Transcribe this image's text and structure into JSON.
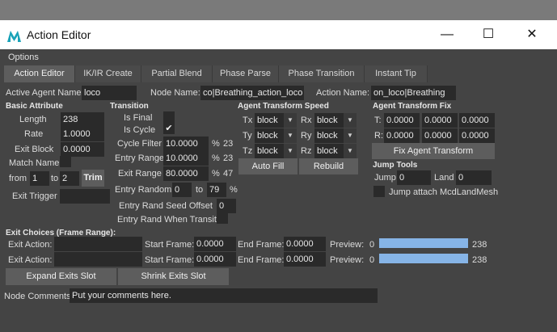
{
  "window": {
    "title": "Action Editor",
    "minimize": "—",
    "maximize": "☐",
    "close": "✕"
  },
  "menu": {
    "options": "Options"
  },
  "tabs": [
    "Action Editor",
    "IK/IR Create",
    "Partial Blend",
    "Phase Parse",
    "Phase Transition",
    "Instant Tip"
  ],
  "top": {
    "active_agent_label": "Active Agent Name:",
    "active_agent_value": "loco",
    "node_name_label": "Node Name:",
    "node_name_value": "co|Breathing_action_loco",
    "action_name_label": "Action Name:",
    "action_name_value": "on_loco|Breathing"
  },
  "basic": {
    "header": "Basic Attribute",
    "length_label": "Length",
    "length_value": "238",
    "rate_label": "Rate",
    "rate_value": "1.0000",
    "exit_block_label": "Exit Block",
    "exit_block_value": "0.0000",
    "match_name_label": "Match Name",
    "from_label": "from",
    "from_value": "1",
    "to_label": "to",
    "to_value": "2",
    "trim_label": "Trim",
    "exit_trigger_label": "Exit Trigger"
  },
  "transition": {
    "header": "Transition",
    "is_final_label": "Is Final",
    "is_cycle_label": "Is Cycle",
    "is_cycle_check": "✔",
    "cycle_filter_label": "Cycle Filter",
    "cycle_filter_value": "10.0000",
    "cycle_filter_pct": "%",
    "cycle_filter_num": "23",
    "entry_range_label": "Entry Range",
    "entry_range_value": "10.0000",
    "entry_range_pct": "%",
    "entry_range_num": "23",
    "exit_range_label": "Exit Range",
    "exit_range_value": "80.0000",
    "exit_range_pct": "%",
    "exit_range_num": "47",
    "entry_random_label": "Entry Random",
    "entry_random_from": "0",
    "entry_random_to_label": "to",
    "entry_random_to": "79",
    "entry_random_pct": "%",
    "seed_offset_label": "Entry Rand Seed Offset",
    "seed_offset_value": "0",
    "when_transit_label": "Entry Rand When Transit"
  },
  "agent_speed": {
    "header": "Agent Transform Speed",
    "tx_label": "Tx",
    "tx_value": "block",
    "ty_label": "Ty",
    "ty_value": "block",
    "tz_label": "Tz",
    "tz_value": "block",
    "rx_label": "Rx",
    "rx_value": "block",
    "ry_label": "Ry",
    "ry_value": "block",
    "rz_label": "Rz",
    "rz_value": "block",
    "auto_fill_label": "Auto Fill",
    "rebuild_label": "Rebuild"
  },
  "agent_fix": {
    "header": "Agent Transform Fix",
    "t_label": "T:",
    "t_values": [
      "0.0000",
      "0.0000",
      "0.0000"
    ],
    "r_label": "R:",
    "r_values": [
      "0.0000",
      "0.0000",
      "0.0000"
    ],
    "fix_button": "Fix Agent Transform"
  },
  "jump": {
    "header": "Jump Tools",
    "jump_label": "Jump",
    "jump_value": "0",
    "land_label": "Land",
    "land_value": "0",
    "attach_label": "Jump attach McdLandMesh"
  },
  "exit_choices": {
    "header": "Exit Choices (Frame Range):",
    "rows": [
      {
        "exit_label": "Exit Action:",
        "start_label": "Start Frame:",
        "start_value": "0.0000",
        "end_label": "End Frame:",
        "end_value": "0.0000",
        "preview_label": "Preview:",
        "min": "0",
        "max": "238",
        "progress": 1.0
      },
      {
        "exit_label": "Exit Action:",
        "start_label": "Start Frame:",
        "start_value": "0.0000",
        "end_label": "End Frame:",
        "end_value": "0.0000",
        "preview_label": "Preview:",
        "min": "0",
        "max": "238",
        "progress": 1.0
      }
    ],
    "expand_label": "Expand Exits Slot",
    "shrink_label": "Shrink Exits Slot"
  },
  "comments": {
    "label": "Node Comments:",
    "value": "Put your comments here."
  },
  "colors": {
    "window_bg": "#444444",
    "field_bg": "#2a2a2a",
    "button_bg": "#5d5d5d",
    "progress": "#86b4e6",
    "title_bg": "#ffffff"
  }
}
